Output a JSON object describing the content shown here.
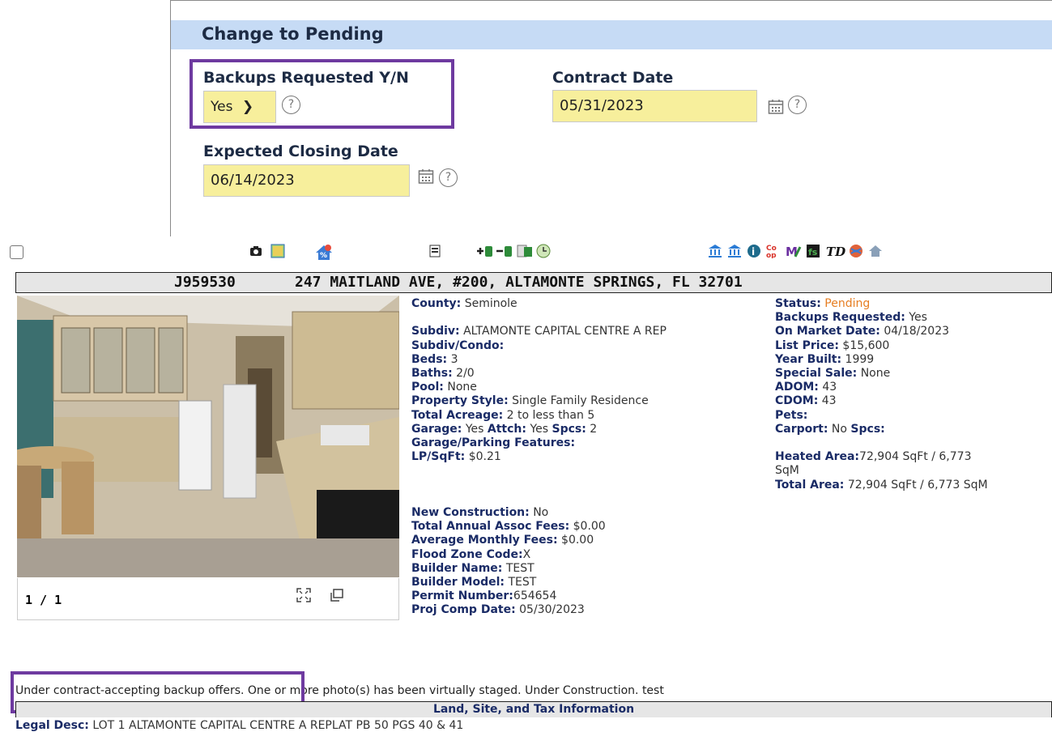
{
  "pending_panel": {
    "title": "Change to Pending",
    "backups": {
      "label": "Backups Requested Y/N",
      "value": "Yes"
    },
    "contract_date": {
      "label": "Contract Date",
      "value": "05/31/2023"
    },
    "expected_closing": {
      "label": "Expected Closing Date",
      "value": "06/14/2023"
    },
    "help_glyph": "?"
  },
  "listing": {
    "mls_number": "J959530",
    "address": "247 MAITLAND AVE, #200, ALTAMONTE SPRINGS, FL 32701",
    "photo_counter": "1 / 1",
    "left_col": {
      "county_l": "County:",
      "county_v": " Seminole",
      "subdiv_l": "Subdiv:",
      "subdiv_v": " ALTAMONTE CAPITAL CENTRE A REP",
      "subdivcondo_l": "Subdiv/Condo:",
      "beds_l": "Beds:",
      "beds_v": " 3",
      "baths_l": "Baths:",
      "baths_v": " 2/0",
      "pool_l": "Pool:",
      "pool_v": " None",
      "style_l": "Property Style:",
      "style_v": " Single Family Residence",
      "acreage_l": "Total Acreage:",
      "acreage_v": " 2 to less than 5",
      "garage_l": "Garage:",
      "garage_v": " Yes ",
      "attch_l": "Attch:",
      "attch_v": " Yes ",
      "spcs_l": "Spcs:",
      "spcs_v": " 2",
      "parking_l": "Garage/Parking Features:",
      "lpsqft_l": "LP/SqFt:",
      "lpsqft_v": " $0.21",
      "newcon_l": "New Construction:",
      "newcon_v": " No",
      "assoc_l": "Total Annual Assoc Fees:",
      "assoc_v": " $0.00",
      "monthly_l": "Average Monthly Fees:",
      "monthly_v": " $0.00",
      "flood_l": "Flood Zone Code:",
      "flood_v": "X",
      "builder_l": "Builder Name:",
      "builder_v": " TEST",
      "model_l": "Builder Model:",
      "model_v": " TEST",
      "permit_l": "Permit Number:",
      "permit_v": "654654",
      "projcomp_l": "Proj Comp Date:",
      "projcomp_v": " 05/30/2023"
    },
    "right_col": {
      "status_l": "Status:",
      "status_v": " Pending",
      "backups_l": "Backups Requested:",
      "backups_v": " Yes",
      "onmarket_l": "On Market Date:",
      "onmarket_v": " 04/18/2023",
      "price_l": "List Price:",
      "price_v": " $15,600",
      "year_l": "Year Built:",
      "year_v": " 1999",
      "special_l": "Special Sale:",
      "special_v": " None",
      "adom_l": "ADOM:",
      "adom_v": " 43",
      "cdom_l": "CDOM:",
      "cdom_v": " 43",
      "pets_l": "Pets:",
      "carport_l": "Carport:",
      "carport_v": " No ",
      "cspcs_l": "Spcs:",
      "heated_l": "Heated Area:",
      "heated_v": "72,904 SqFt / 6,773",
      "heated_v2": "SqM",
      "total_l": "Total Area:",
      "total_v": " 72,904 SqFt / 6,773 SqM"
    },
    "remarks": "Under contract-accepting backup offers. One or more photo(s) has been virtually staged. Under Construction. test",
    "section_title": "Land, Site, and Tax Information",
    "legal_l": "Legal Desc:",
    "legal_v": " LOT 1 ALTAMONTE CAPITAL CENTRE A REPLAT PB 50 PGS 40 & 41"
  },
  "colors": {
    "panel_header": "#c6dbf5",
    "field_bg": "#f7ef9c",
    "highlight": "#6e3aa0",
    "label_navy": "#1a2b66",
    "status_orange": "#e67e22"
  }
}
